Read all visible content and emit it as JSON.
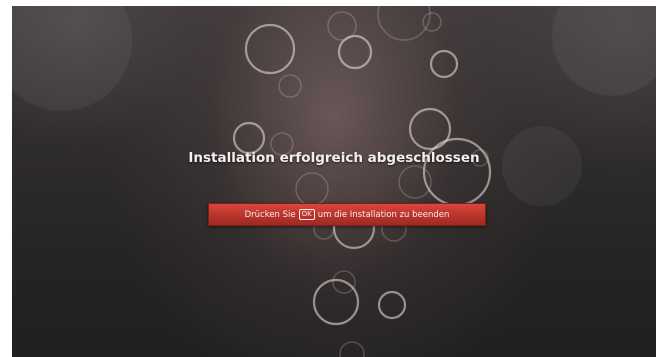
{
  "screen": {
    "title": "Installation erfolgreich abgeschlossen"
  },
  "prompt": {
    "prefix": "Drücken Sie",
    "key_label": "OK",
    "suffix": "um die Installation zu beenden"
  },
  "colors": {
    "accent_bar": "#c0392b",
    "background": "#2f2c2c",
    "text": "#f4efef"
  }
}
